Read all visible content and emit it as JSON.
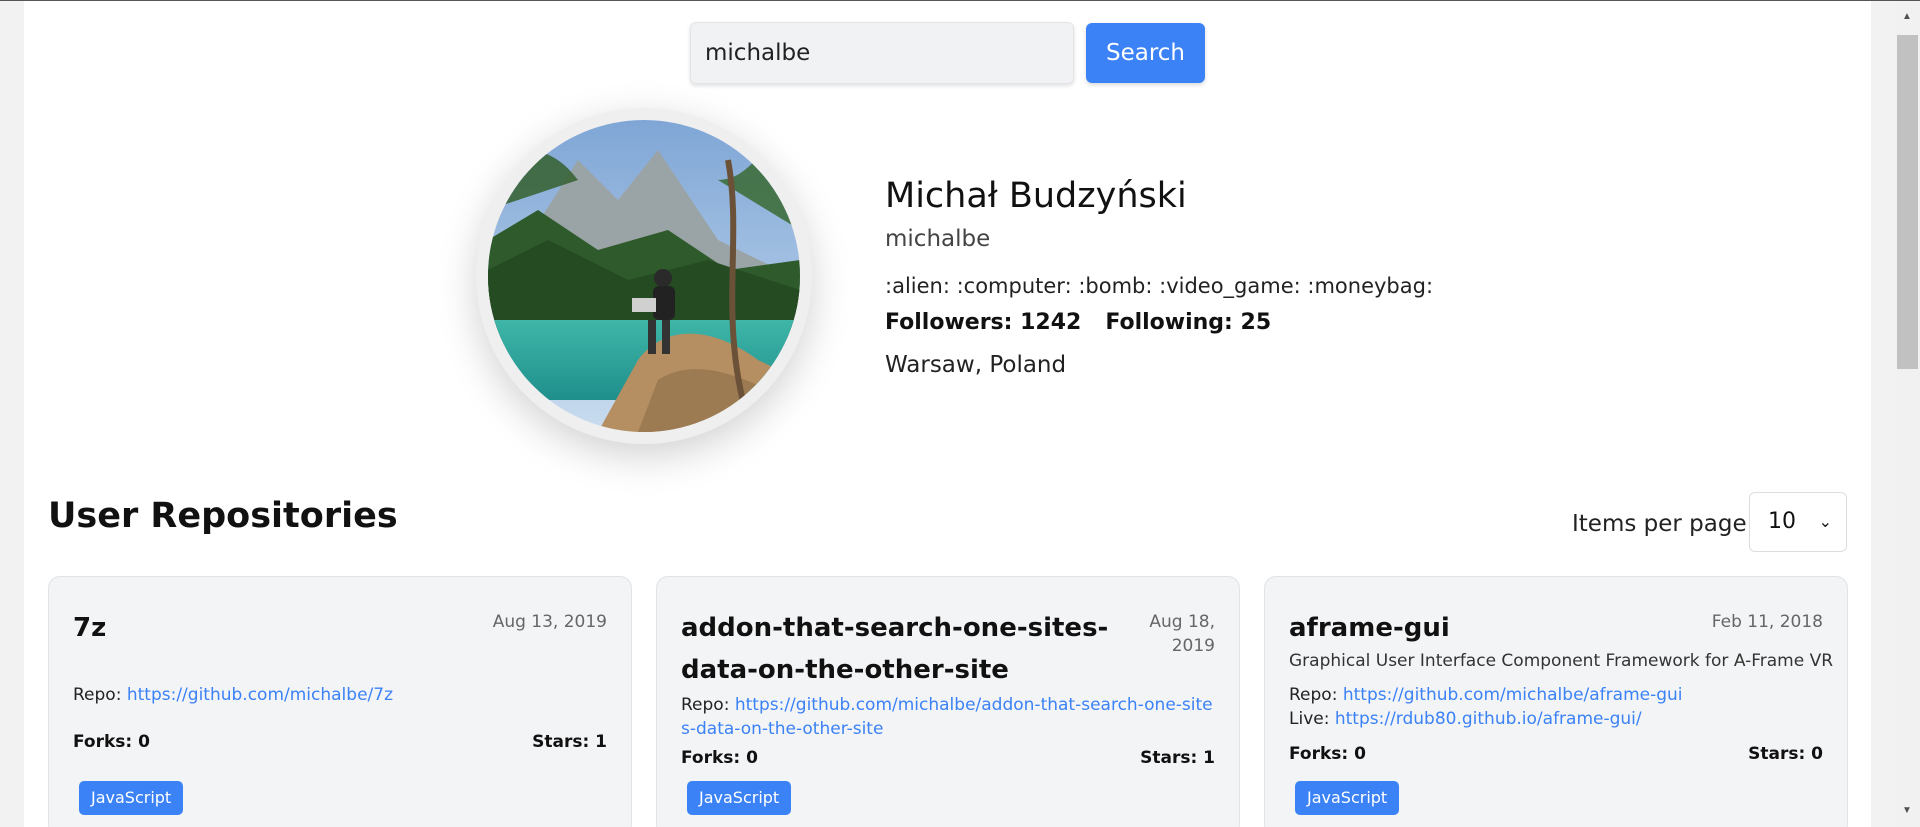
{
  "search": {
    "value": "michalbe",
    "button_label": "Search"
  },
  "profile": {
    "name": "Michał Budzyński",
    "login": "michalbe",
    "bio": ":alien: :computer: :bomb: :video_game: :moneybag:",
    "followers_label": "Followers: 1242",
    "following_label": "Following: 25",
    "location": "Warsaw, Poland"
  },
  "repos": {
    "title": "User Repositories",
    "per_page_label": "Items per page:",
    "per_page_value": "10",
    "items": [
      {
        "name": "7z",
        "date": "Aug 13, 2019",
        "description": "",
        "repo_label": "Repo:",
        "repo_url": "https://github.com/michalbe/7z",
        "live_label": "",
        "live_url": "",
        "forks": "Forks: 0",
        "stars": "Stars: 1",
        "language": "JavaScript"
      },
      {
        "name": "addon-that-search-one-sites-data-on-the-other-site",
        "date": "Aug 18, 2019",
        "description": "",
        "repo_label": "Repo:",
        "repo_url": "https://github.com/michalbe/addon-that-search-one-sites-data-on-the-other-site",
        "live_label": "",
        "live_url": "",
        "forks": "Forks: 0",
        "stars": "Stars: 1",
        "language": "JavaScript"
      },
      {
        "name": "aframe-gui",
        "date": "Feb 11, 2018",
        "description": "Graphical User Interface Component Framework for A-Frame VR",
        "repo_label": "Repo:",
        "repo_url": "https://github.com/michalbe/aframe-gui",
        "live_label": "Live:",
        "live_url": "https://rdub80.github.io/aframe-gui/",
        "forks": "Forks: 0",
        "stars": "Stars: 0",
        "language": "JavaScript"
      }
    ]
  },
  "colors": {
    "accent": "#3b82f6",
    "card_bg": "#f3f4f6"
  },
  "icons": {
    "select_chevron": "chevron-down-icon",
    "scroll_up": "scroll-up-arrow-icon",
    "scroll_down": "scroll-down-arrow-icon"
  }
}
